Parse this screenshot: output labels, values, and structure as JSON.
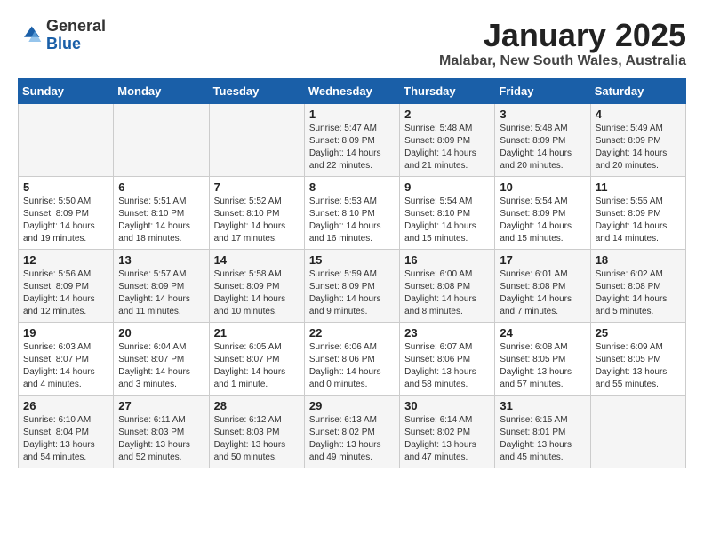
{
  "logo": {
    "general": "General",
    "blue": "Blue"
  },
  "title": "January 2025",
  "subtitle": "Malabar, New South Wales, Australia",
  "headers": [
    "Sunday",
    "Monday",
    "Tuesday",
    "Wednesday",
    "Thursday",
    "Friday",
    "Saturday"
  ],
  "weeks": [
    [
      {
        "day": "",
        "info": ""
      },
      {
        "day": "",
        "info": ""
      },
      {
        "day": "",
        "info": ""
      },
      {
        "day": "1",
        "info": "Sunrise: 5:47 AM\nSunset: 8:09 PM\nDaylight: 14 hours\nand 22 minutes."
      },
      {
        "day": "2",
        "info": "Sunrise: 5:48 AM\nSunset: 8:09 PM\nDaylight: 14 hours\nand 21 minutes."
      },
      {
        "day": "3",
        "info": "Sunrise: 5:48 AM\nSunset: 8:09 PM\nDaylight: 14 hours\nand 20 minutes."
      },
      {
        "day": "4",
        "info": "Sunrise: 5:49 AM\nSunset: 8:09 PM\nDaylight: 14 hours\nand 20 minutes."
      }
    ],
    [
      {
        "day": "5",
        "info": "Sunrise: 5:50 AM\nSunset: 8:09 PM\nDaylight: 14 hours\nand 19 minutes."
      },
      {
        "day": "6",
        "info": "Sunrise: 5:51 AM\nSunset: 8:10 PM\nDaylight: 14 hours\nand 18 minutes."
      },
      {
        "day": "7",
        "info": "Sunrise: 5:52 AM\nSunset: 8:10 PM\nDaylight: 14 hours\nand 17 minutes."
      },
      {
        "day": "8",
        "info": "Sunrise: 5:53 AM\nSunset: 8:10 PM\nDaylight: 14 hours\nand 16 minutes."
      },
      {
        "day": "9",
        "info": "Sunrise: 5:54 AM\nSunset: 8:10 PM\nDaylight: 14 hours\nand 15 minutes."
      },
      {
        "day": "10",
        "info": "Sunrise: 5:54 AM\nSunset: 8:09 PM\nDaylight: 14 hours\nand 15 minutes."
      },
      {
        "day": "11",
        "info": "Sunrise: 5:55 AM\nSunset: 8:09 PM\nDaylight: 14 hours\nand 14 minutes."
      }
    ],
    [
      {
        "day": "12",
        "info": "Sunrise: 5:56 AM\nSunset: 8:09 PM\nDaylight: 14 hours\nand 12 minutes."
      },
      {
        "day": "13",
        "info": "Sunrise: 5:57 AM\nSunset: 8:09 PM\nDaylight: 14 hours\nand 11 minutes."
      },
      {
        "day": "14",
        "info": "Sunrise: 5:58 AM\nSunset: 8:09 PM\nDaylight: 14 hours\nand 10 minutes."
      },
      {
        "day": "15",
        "info": "Sunrise: 5:59 AM\nSunset: 8:09 PM\nDaylight: 14 hours\nand 9 minutes."
      },
      {
        "day": "16",
        "info": "Sunrise: 6:00 AM\nSunset: 8:08 PM\nDaylight: 14 hours\nand 8 minutes."
      },
      {
        "day": "17",
        "info": "Sunrise: 6:01 AM\nSunset: 8:08 PM\nDaylight: 14 hours\nand 7 minutes."
      },
      {
        "day": "18",
        "info": "Sunrise: 6:02 AM\nSunset: 8:08 PM\nDaylight: 14 hours\nand 5 minutes."
      }
    ],
    [
      {
        "day": "19",
        "info": "Sunrise: 6:03 AM\nSunset: 8:07 PM\nDaylight: 14 hours\nand 4 minutes."
      },
      {
        "day": "20",
        "info": "Sunrise: 6:04 AM\nSunset: 8:07 PM\nDaylight: 14 hours\nand 3 minutes."
      },
      {
        "day": "21",
        "info": "Sunrise: 6:05 AM\nSunset: 8:07 PM\nDaylight: 14 hours\nand 1 minute."
      },
      {
        "day": "22",
        "info": "Sunrise: 6:06 AM\nSunset: 8:06 PM\nDaylight: 14 hours\nand 0 minutes."
      },
      {
        "day": "23",
        "info": "Sunrise: 6:07 AM\nSunset: 8:06 PM\nDaylight: 13 hours\nand 58 minutes."
      },
      {
        "day": "24",
        "info": "Sunrise: 6:08 AM\nSunset: 8:05 PM\nDaylight: 13 hours\nand 57 minutes."
      },
      {
        "day": "25",
        "info": "Sunrise: 6:09 AM\nSunset: 8:05 PM\nDaylight: 13 hours\nand 55 minutes."
      }
    ],
    [
      {
        "day": "26",
        "info": "Sunrise: 6:10 AM\nSunset: 8:04 PM\nDaylight: 13 hours\nand 54 minutes."
      },
      {
        "day": "27",
        "info": "Sunrise: 6:11 AM\nSunset: 8:03 PM\nDaylight: 13 hours\nand 52 minutes."
      },
      {
        "day": "28",
        "info": "Sunrise: 6:12 AM\nSunset: 8:03 PM\nDaylight: 13 hours\nand 50 minutes."
      },
      {
        "day": "29",
        "info": "Sunrise: 6:13 AM\nSunset: 8:02 PM\nDaylight: 13 hours\nand 49 minutes."
      },
      {
        "day": "30",
        "info": "Sunrise: 6:14 AM\nSunset: 8:02 PM\nDaylight: 13 hours\nand 47 minutes."
      },
      {
        "day": "31",
        "info": "Sunrise: 6:15 AM\nSunset: 8:01 PM\nDaylight: 13 hours\nand 45 minutes."
      },
      {
        "day": "",
        "info": ""
      }
    ]
  ]
}
